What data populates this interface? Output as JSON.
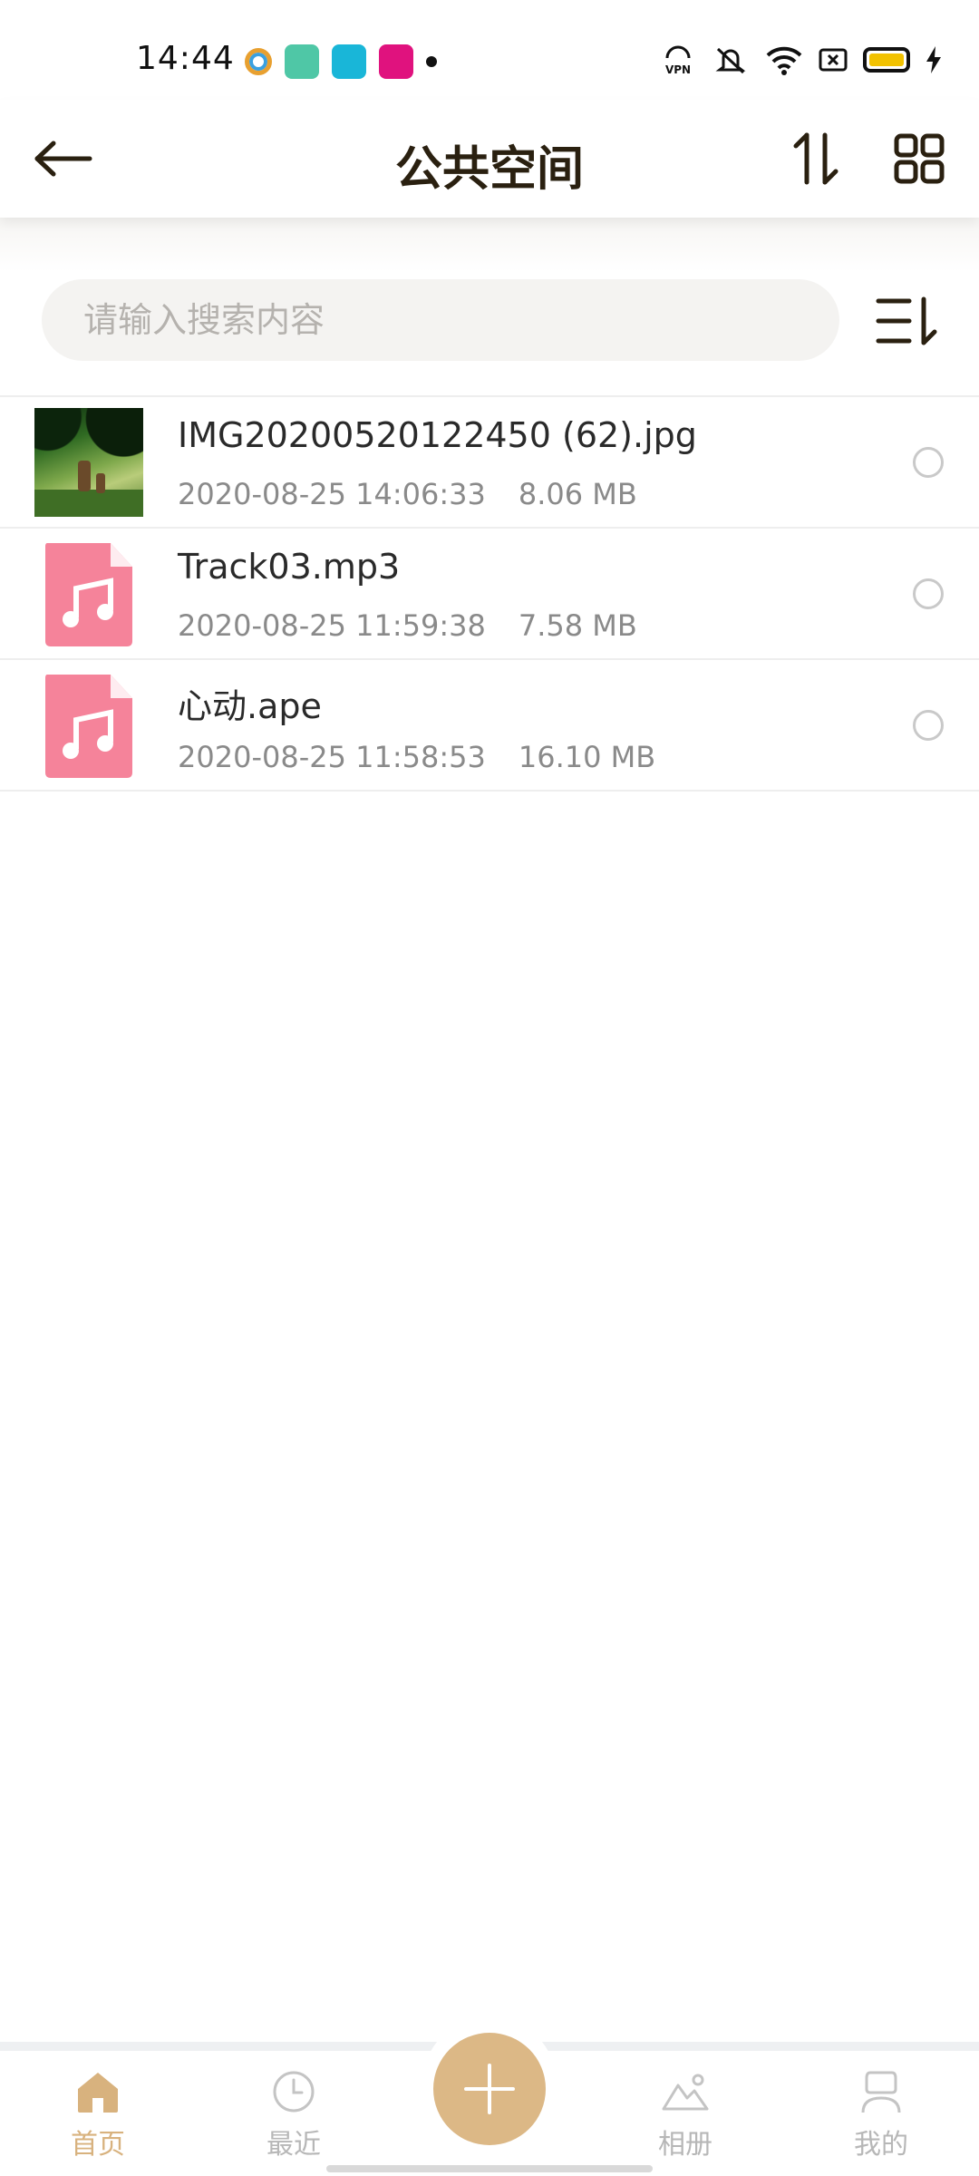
{
  "status_bar": {
    "time": "14:44",
    "notification_icons": [
      "browser-app-icon",
      "calendar-app-icon",
      "camera-app-icon",
      "news-app-icon"
    ],
    "system_icons": [
      "vpn-icon",
      "mute-icon",
      "wifi-icon",
      "sim-icon",
      "battery-icon",
      "charging-icon"
    ]
  },
  "header": {
    "title": "公共空间",
    "back_icon": "arrow-left-icon",
    "sort_icon": "sort-arrows-icon",
    "grid_icon": "grid-view-icon"
  },
  "search": {
    "placeholder": "请输入搜索内容",
    "value": "",
    "filter_icon": "sort-list-icon"
  },
  "files": [
    {
      "name": "IMG20200520122450 (62).jpg",
      "date": "2020-08-25 14:06:33",
      "size": "8.06 MB",
      "type": "image"
    },
    {
      "name": "Track03.mp3",
      "date": "2020-08-25 11:59:38",
      "size": "7.58 MB",
      "type": "audio"
    },
    {
      "name": "心动.ape",
      "date": "2020-08-25 11:58:53",
      "size": "16.10 MB",
      "type": "audio"
    }
  ],
  "bottom_nav": {
    "items": [
      {
        "label": "首页",
        "icon": "home-icon",
        "active": true
      },
      {
        "label": "最近",
        "icon": "clock-icon",
        "active": false
      },
      {
        "label": "相册",
        "icon": "mountain-photo-icon",
        "active": false
      },
      {
        "label": "我的",
        "icon": "user-icon",
        "active": false
      }
    ],
    "fab_icon": "plus-icon"
  },
  "colors": {
    "accent": "#DCB886",
    "active_nav": "#D8B27E",
    "audio_icon": "#F5839A",
    "title": "#2A2010"
  }
}
